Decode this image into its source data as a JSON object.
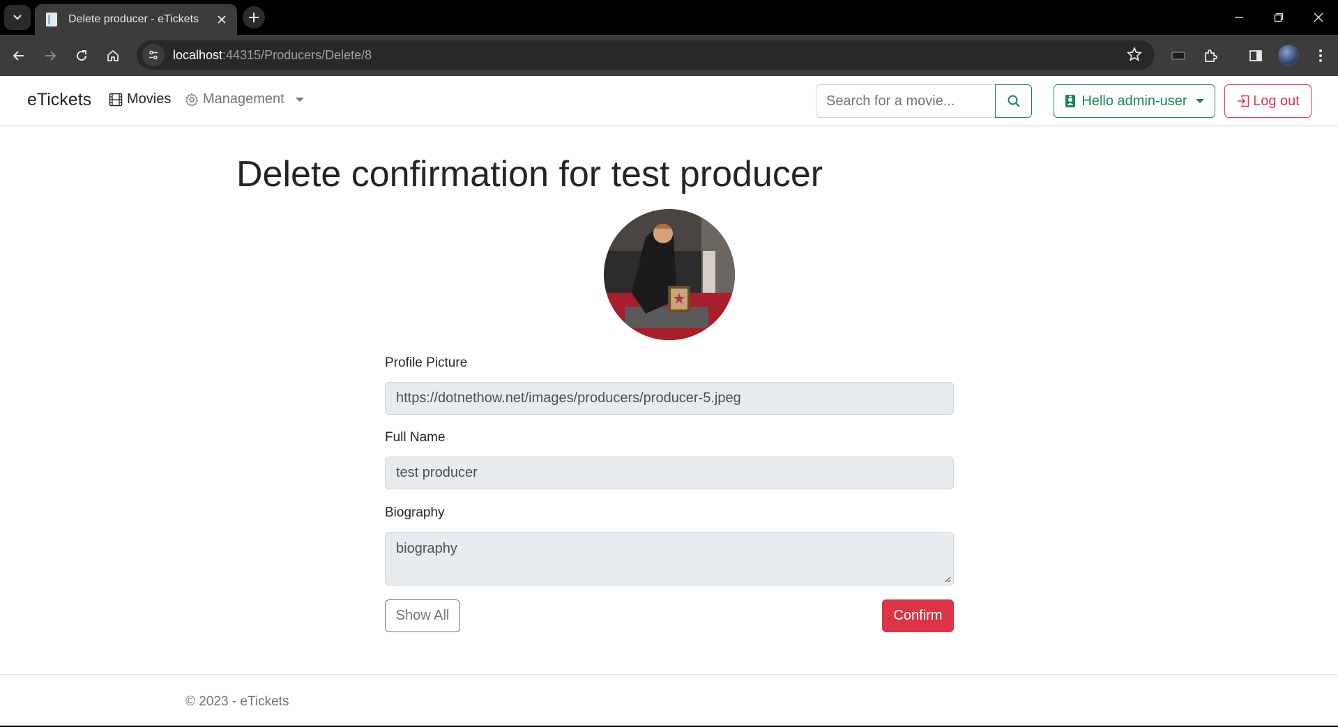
{
  "browser": {
    "tab_title": "Delete producer - eTickets",
    "url_host": "localhost",
    "url_path": ":44315/Producers/Delete/8"
  },
  "navbar": {
    "brand": "eTickets",
    "movies_label": "Movies",
    "management_label": "Management",
    "search_placeholder": "Search for a movie...",
    "user_label": "Hello admin-user",
    "logout_label": "Log out"
  },
  "page": {
    "title": "Delete confirmation for test producer",
    "fields": {
      "profile_picture_label": "Profile Picture",
      "profile_picture_value": "https://dotnethow.net/images/producers/producer-5.jpeg",
      "full_name_label": "Full Name",
      "full_name_value": "test producer",
      "biography_label": "Biography",
      "biography_value": "biography"
    },
    "show_all_label": "Show All",
    "confirm_label": "Confirm"
  },
  "footer": {
    "text": "© 2023 - eTickets"
  },
  "colors": {
    "success": "#198754",
    "danger": "#dc3545",
    "secondary": "#6c757d"
  }
}
